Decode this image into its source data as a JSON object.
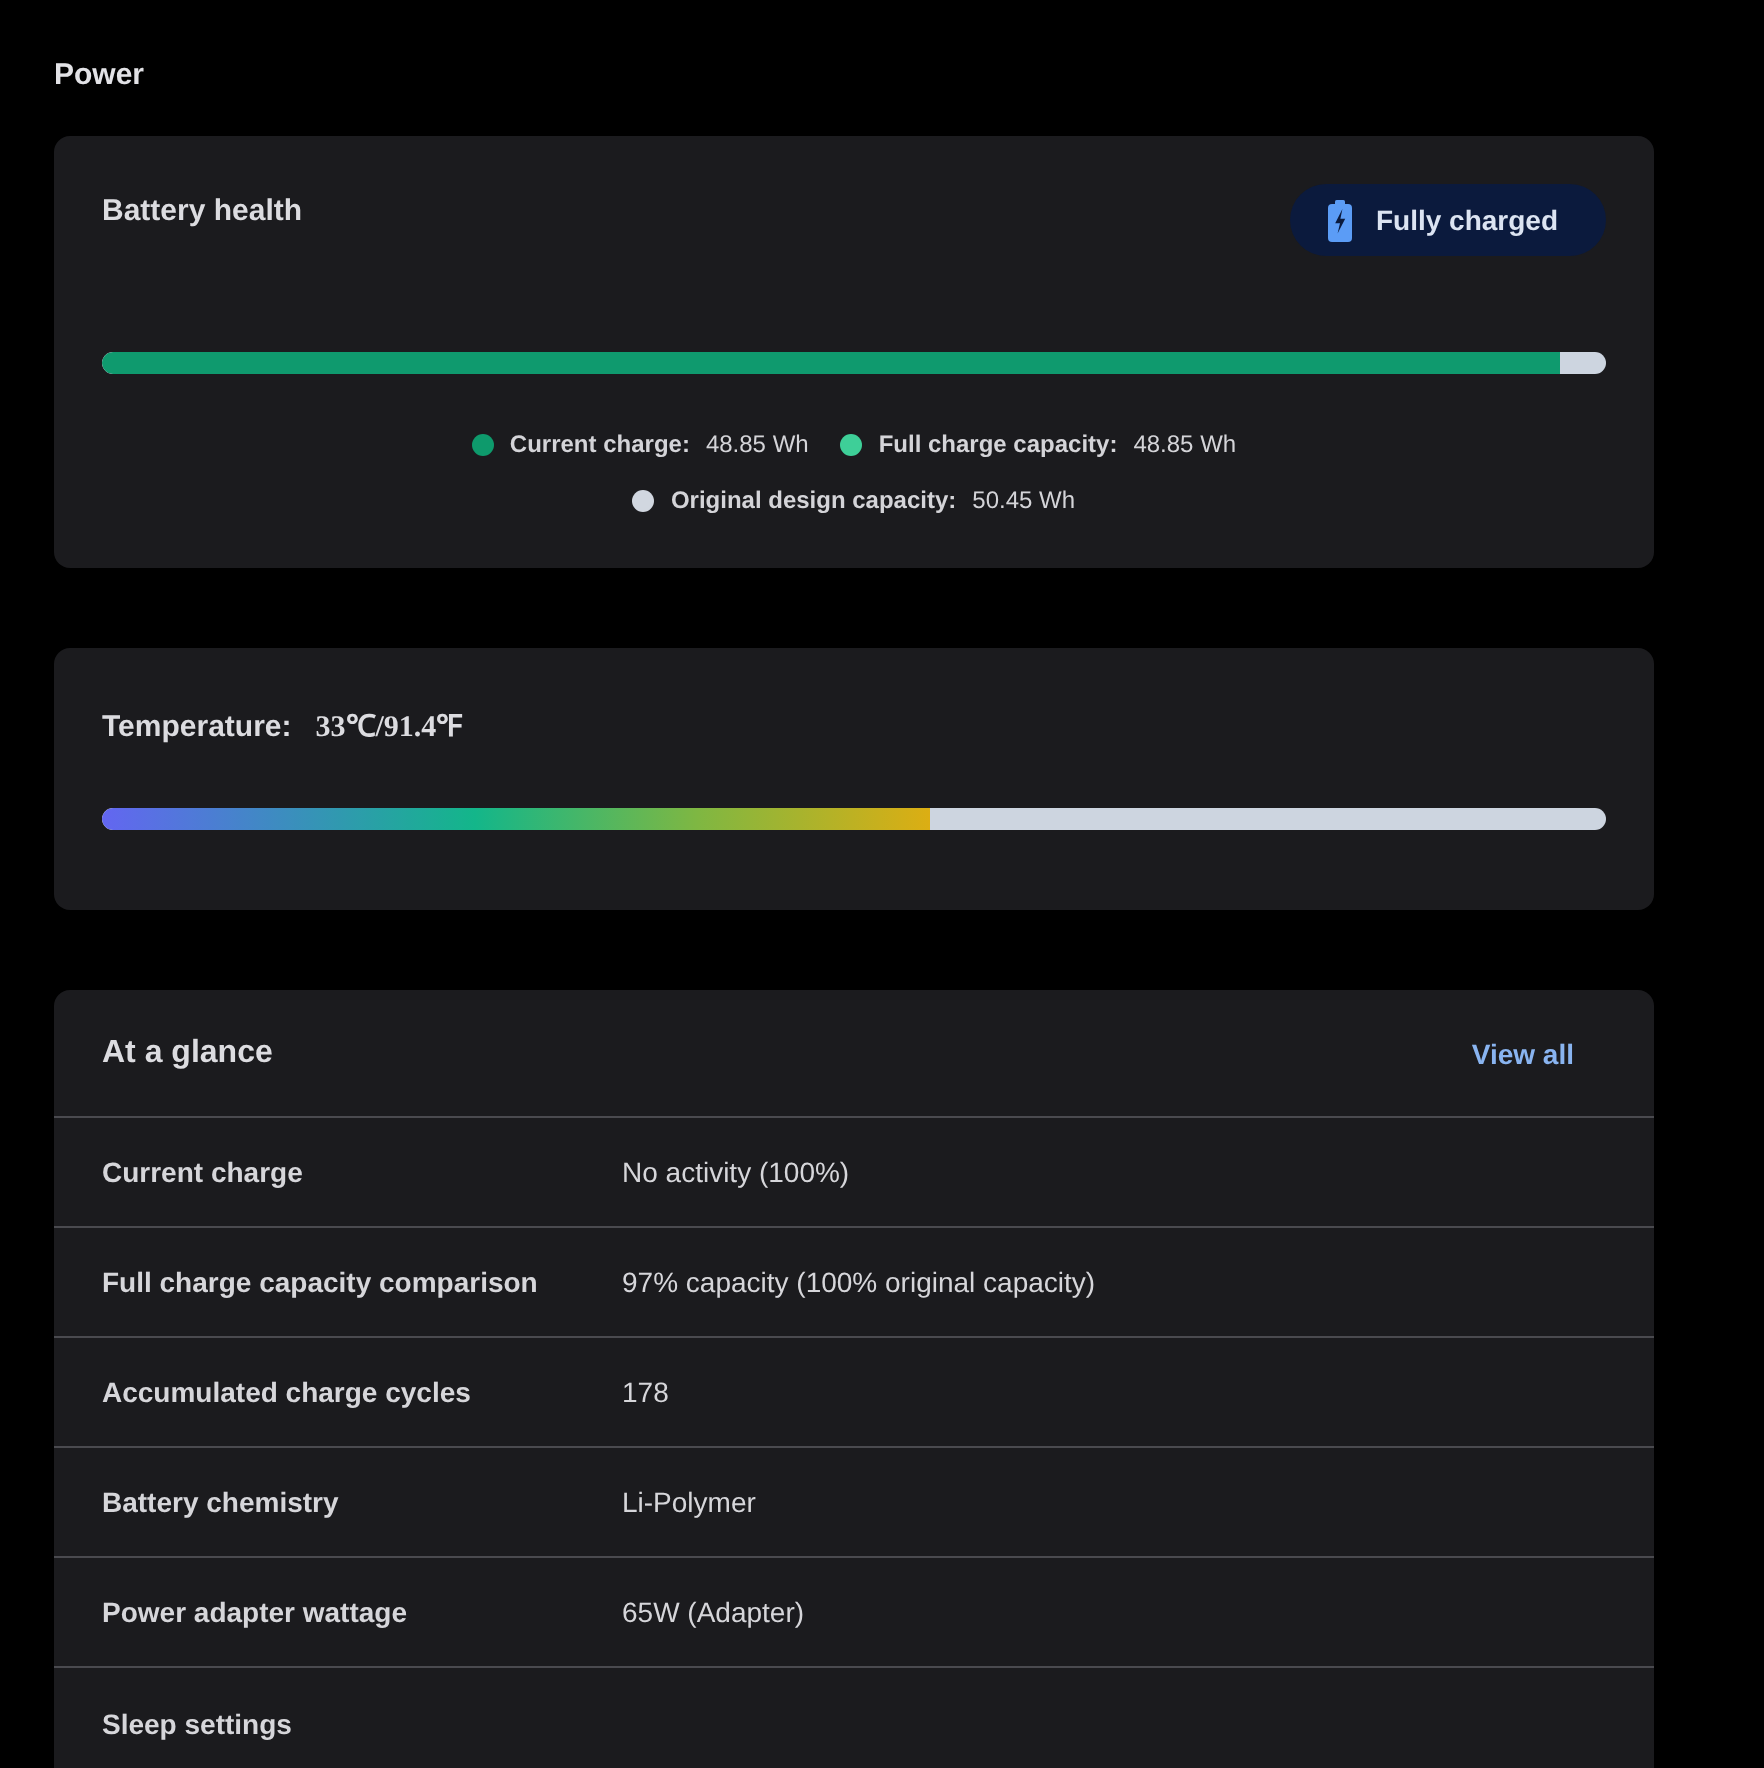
{
  "page": {
    "title": "Power"
  },
  "battery_health": {
    "title": "Battery health",
    "status_badge": {
      "label": "Fully charged"
    },
    "charge_bar": {
      "level": 0.97
    },
    "legend": [
      {
        "label": "Current charge:",
        "value": "48.85 Wh",
        "color": "#0e9a6c"
      },
      {
        "label": "Full charge capacity:",
        "value": "48.85 Wh",
        "color": "#3ecf98"
      },
      {
        "label": "Original design capacity:",
        "value": "50.45 Wh",
        "color": "#d1d7e0"
      }
    ]
  },
  "temperature": {
    "label": "Temperature:",
    "value": "33℃/91.4℉",
    "bar": {
      "level": 0.55
    }
  },
  "at_a_glance": {
    "title": "At a glance",
    "link": "View all",
    "rows": [
      {
        "label": "Current charge",
        "value": "No activity (100%)"
      },
      {
        "label": "Full charge capacity comparison",
        "value": "97% capacity (100% original capacity)"
      },
      {
        "label": "Accumulated charge cycles",
        "value": "178"
      },
      {
        "label": "Battery chemistry",
        "value": "Li-Polymer"
      },
      {
        "label": "Power adapter wattage",
        "value": "65W (Adapter)"
      },
      {
        "label": "Sleep settings"
      }
    ]
  }
}
